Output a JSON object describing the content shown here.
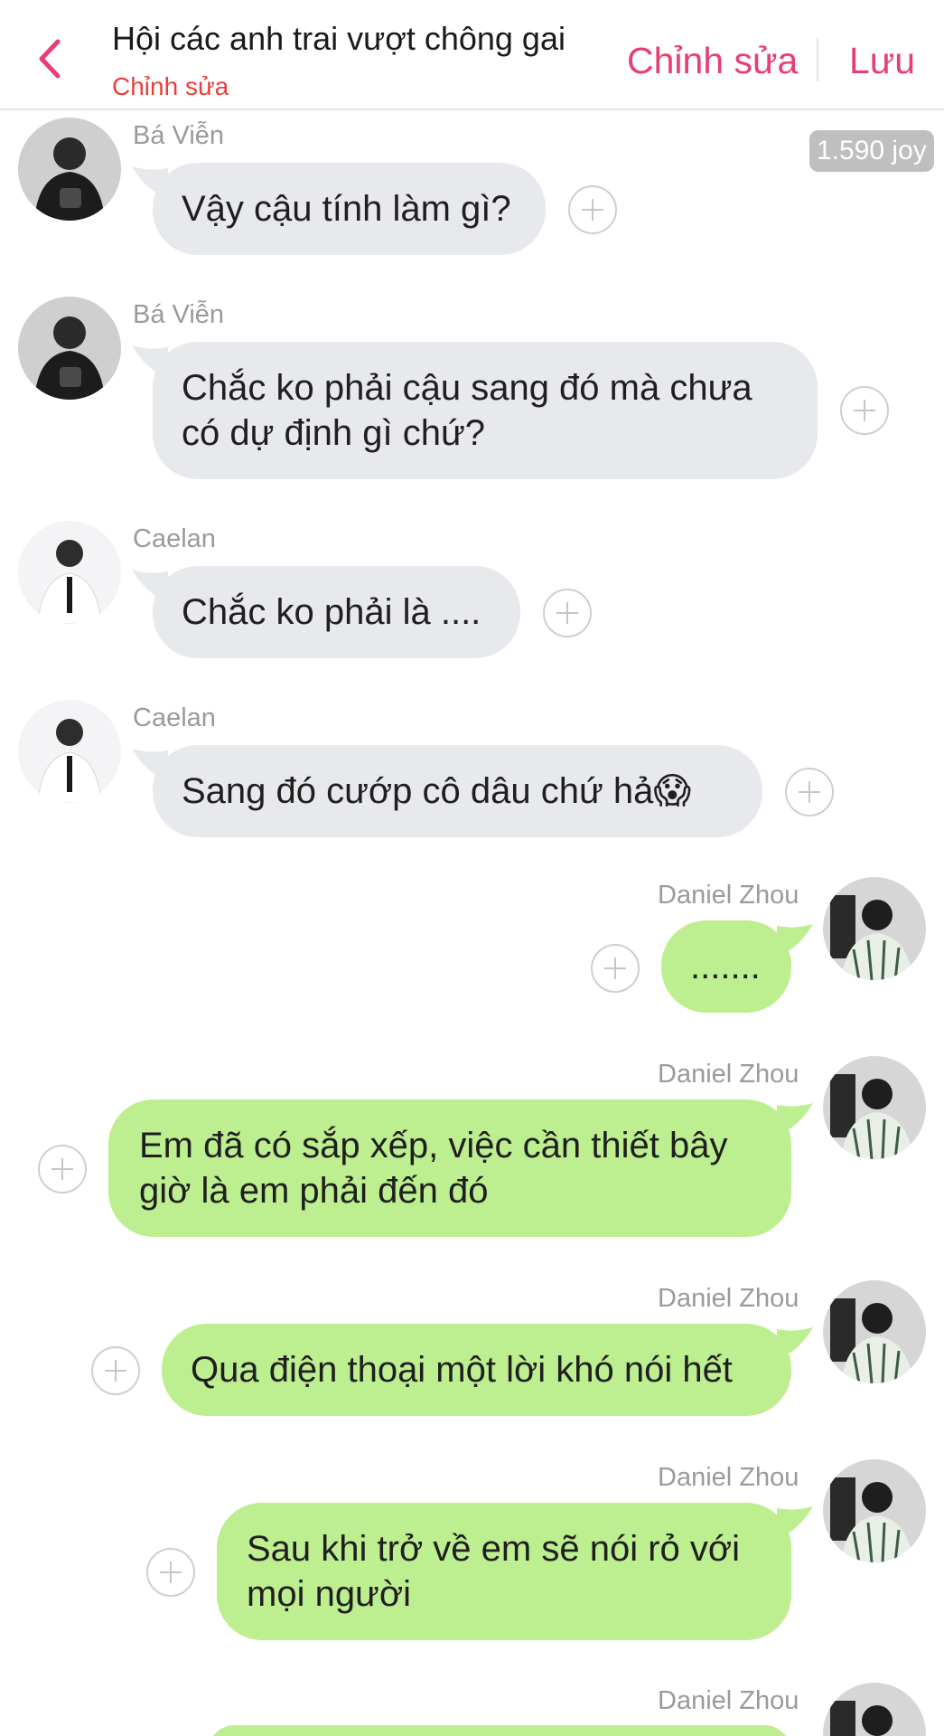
{
  "header": {
    "back_icon": "chevron-left-icon",
    "title": "Hội các anh trai vượt chông gai",
    "subtitle": "Chỉnh sửa",
    "edit_label": "Chỉnh sửa",
    "save_label": "Lưu",
    "accent_color": "#e83f73"
  },
  "badge": "1.590 joy",
  "messages": [
    {
      "sender": "Bá Viễn",
      "side": "in",
      "lines": [
        "Vậy cậu tính làm gì?"
      ]
    },
    {
      "sender": "Bá Viễn",
      "side": "in",
      "lines": [
        "Chắc ko phải cậu sang đó mà chưa",
        "có dự định gì chứ?"
      ]
    },
    {
      "sender": "Caelan",
      "side": "in",
      "lines": [
        "Chắc ko phải là ...."
      ]
    },
    {
      "sender": "Caelan",
      "side": "in",
      "lines": [
        "Sang đó cướp cô dâu chứ  hả😱"
      ]
    },
    {
      "sender": "Daniel Zhou",
      "side": "out",
      "lines": [
        "......."
      ]
    },
    {
      "sender": "Daniel Zhou",
      "side": "out",
      "lines": [
        "Em đã có sắp xếp, việc cần thiết bây",
        "giờ là em phải đến đó"
      ]
    },
    {
      "sender": "Daniel Zhou",
      "side": "out",
      "lines": [
        "Qua điện thoại một lời khó nói hết"
      ]
    },
    {
      "sender": "Daniel Zhou",
      "side": "out",
      "lines": [
        "Sau khi trở về em sẽ nói rỏ với",
        "mọi người"
      ]
    },
    {
      "sender": "Daniel Zhou",
      "side": "out",
      "lines": []
    }
  ],
  "colors": {
    "incoming_bubble": "#e7e9ec",
    "outgoing_bubble": "#bdee8f",
    "subtitle": "#e8403a"
  }
}
